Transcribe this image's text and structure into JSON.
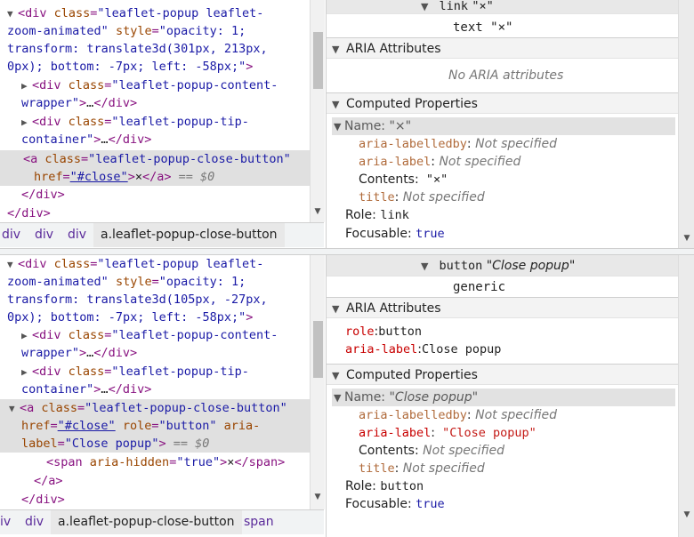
{
  "top": {
    "dom_lines": [
      {
        "parts": [
          [
            "tag",
            "<div "
          ],
          [
            "attr",
            "class"
          ],
          [
            "tag",
            "="
          ],
          [
            "val",
            "\"leaflet-popup  leaflet-"
          ]
        ]
      },
      {
        "parts": [
          [
            "val",
            "zoom-animated\""
          ],
          [
            "tag",
            " "
          ],
          [
            "attr",
            "style"
          ],
          [
            "tag",
            "="
          ],
          [
            "val",
            "\"opacity: 1;"
          ]
        ]
      },
      {
        "parts": [
          [
            "val",
            "transform: translate3d(301px, 213px,"
          ]
        ]
      },
      {
        "parts": [
          [
            "val",
            "0px); bottom: -7px; left: -58px;\""
          ],
          [
            "tag",
            ">"
          ]
        ]
      },
      {
        "parts": [
          [
            "tag",
            "<div "
          ],
          [
            "attr",
            "class"
          ],
          [
            "tag",
            "="
          ],
          [
            "val",
            "\"leaflet-popup-content-"
          ]
        ]
      },
      {
        "parts": [
          [
            "val",
            "wrapper\""
          ],
          [
            "tag",
            ">"
          ],
          [
            "plain",
            "…"
          ],
          [
            "tag",
            "</div>"
          ]
        ]
      },
      {
        "parts": [
          [
            "tag",
            "<div "
          ],
          [
            "attr",
            "class"
          ],
          [
            "tag",
            "="
          ],
          [
            "val",
            "\"leaflet-popup-tip-"
          ]
        ]
      },
      {
        "parts": [
          [
            "val",
            "container\""
          ],
          [
            "tag",
            ">"
          ],
          [
            "plain",
            "…"
          ],
          [
            "tag",
            "</div>"
          ]
        ]
      },
      {
        "parts": [
          [
            "tag",
            "<a "
          ],
          [
            "attr",
            "class"
          ],
          [
            "tag",
            "="
          ],
          [
            "val",
            "\"leaflet-popup-close-button\""
          ]
        ]
      },
      {
        "parts": [
          [
            "attr",
            "href"
          ],
          [
            "tag",
            "="
          ],
          [
            "link",
            "\"#close\""
          ],
          [
            "tag",
            ">"
          ],
          [
            "plain",
            "×"
          ],
          [
            "tag",
            "</a>"
          ],
          [
            "eq0",
            " == $0"
          ]
        ]
      },
      {
        "parts": [
          [
            "tag",
            "</div>"
          ]
        ]
      },
      {
        "parts": [
          [
            "tag",
            "</div>"
          ]
        ]
      }
    ],
    "crumbs": [
      "div",
      "div",
      "div",
      "a.leaflet-popup-close-button"
    ],
    "ax": {
      "node_role": "link",
      "node_name": "\"×\"",
      "child_text": "text \"×\"",
      "sec_aria": "ARIA Attributes",
      "no_aria": "No ARIA attributes",
      "sec_computed": "Computed Properties",
      "name_label": "Name:",
      "name_value": "\"×\"",
      "props": [
        {
          "k": "aria-labelledby",
          "sep": ":",
          "v": " Not specified",
          "ks": "dim",
          "vs": "ns"
        },
        {
          "k": "aria-label",
          "sep": ":",
          "v": " Not specified",
          "ks": "dim",
          "vs": "ns"
        },
        {
          "k": "Contents",
          "sep": ":",
          "v": " \"×\"",
          "ks": "plainlbl",
          "vs": "plain"
        },
        {
          "k": "title",
          "sep": ":",
          "v": " Not specified",
          "ks": "dim",
          "vs": "ns"
        }
      ],
      "role_label": "Role:",
      "role_value": "link",
      "focus_label": "Focusable:",
      "focus_value": "true"
    }
  },
  "bottom": {
    "dom_lines": [
      {
        "parts": [
          [
            "tag",
            "<div "
          ],
          [
            "attr",
            "class"
          ],
          [
            "tag",
            "="
          ],
          [
            "val",
            "\"leaflet-popup  leaflet-"
          ]
        ]
      },
      {
        "parts": [
          [
            "val",
            "zoom-animated\""
          ],
          [
            "tag",
            " "
          ],
          [
            "attr",
            "style"
          ],
          [
            "tag",
            "="
          ],
          [
            "val",
            "\"opacity: 1;"
          ]
        ]
      },
      {
        "parts": [
          [
            "val",
            "transform: translate3d(105px, -27px,"
          ]
        ]
      },
      {
        "parts": [
          [
            "val",
            "0px); bottom: -7px; left: -58px;\""
          ],
          [
            "tag",
            ">"
          ]
        ]
      },
      {
        "parts": [
          [
            "tag",
            "<div "
          ],
          [
            "attr",
            "class"
          ],
          [
            "tag",
            "="
          ],
          [
            "val",
            "\"leaflet-popup-content-"
          ]
        ]
      },
      {
        "parts": [
          [
            "val",
            "wrapper\""
          ],
          [
            "tag",
            ">"
          ],
          [
            "plain",
            "…"
          ],
          [
            "tag",
            "</div>"
          ]
        ]
      },
      {
        "parts": [
          [
            "tag",
            "<div "
          ],
          [
            "attr",
            "class"
          ],
          [
            "tag",
            "="
          ],
          [
            "val",
            "\"leaflet-popup-tip-"
          ]
        ]
      },
      {
        "parts": [
          [
            "val",
            "container\""
          ],
          [
            "tag",
            ">"
          ],
          [
            "plain",
            "…"
          ],
          [
            "tag",
            "</div>"
          ]
        ]
      },
      {
        "parts": [
          [
            "tag",
            "<a "
          ],
          [
            "attr",
            "class"
          ],
          [
            "tag",
            "="
          ],
          [
            "val",
            "\"leaflet-popup-close-button\""
          ]
        ]
      },
      {
        "parts": [
          [
            "attr",
            "href"
          ],
          [
            "tag",
            "="
          ],
          [
            "link",
            "\"#close\""
          ],
          [
            "tag",
            " "
          ],
          [
            "attr",
            "role"
          ],
          [
            "tag",
            "="
          ],
          [
            "val",
            "\"button\""
          ],
          [
            "tag",
            " "
          ],
          [
            "attr",
            "aria-"
          ]
        ]
      },
      {
        "parts": [
          [
            "attr",
            "label"
          ],
          [
            "tag",
            "="
          ],
          [
            "val",
            "\"Close popup\""
          ],
          [
            "tag",
            ">"
          ],
          [
            "eq0",
            " == $0"
          ]
        ]
      },
      {
        "parts": [
          [
            "tag",
            "<span "
          ],
          [
            "attr",
            "aria-hidden"
          ],
          [
            "tag",
            "="
          ],
          [
            "val",
            "\"true\""
          ],
          [
            "tag",
            ">"
          ],
          [
            "plain",
            "×"
          ],
          [
            "tag",
            "</span>"
          ]
        ]
      },
      {
        "parts": [
          [
            "tag",
            "</a>"
          ]
        ]
      },
      {
        "parts": [
          [
            "tag",
            "</div>"
          ]
        ]
      }
    ],
    "crumbs": [
      "iv",
      "div",
      "a.leaflet-popup-close-button",
      "span"
    ],
    "ax": {
      "node_role": "button",
      "node_name": "\"Close popup\"",
      "child_text": "generic",
      "sec_aria": "ARIA Attributes",
      "aria_attrs": [
        {
          "k": "role",
          "v": "button"
        },
        {
          "k": "aria-label",
          "v": "Close popup"
        }
      ],
      "sec_computed": "Computed Properties",
      "name_label": "Name:",
      "name_value": "\"Close popup\"",
      "props": [
        {
          "k": "aria-labelledby",
          "sep": ":",
          "v": " Not specified",
          "ks": "dim",
          "vs": "ns"
        },
        {
          "k": "aria-label",
          "sep": ":",
          "v": " \"Close popup\"",
          "ks": "key",
          "vs": "str"
        },
        {
          "k": "Contents",
          "sep": ":",
          "v": " Not specified",
          "ks": "plainlbl",
          "vs": "ns"
        },
        {
          "k": "title",
          "sep": ":",
          "v": " Not specified",
          "ks": "dim",
          "vs": "ns"
        }
      ],
      "role_label": "Role:",
      "role_value": "button",
      "focus_label": "Focusable:",
      "focus_value": "true"
    }
  }
}
